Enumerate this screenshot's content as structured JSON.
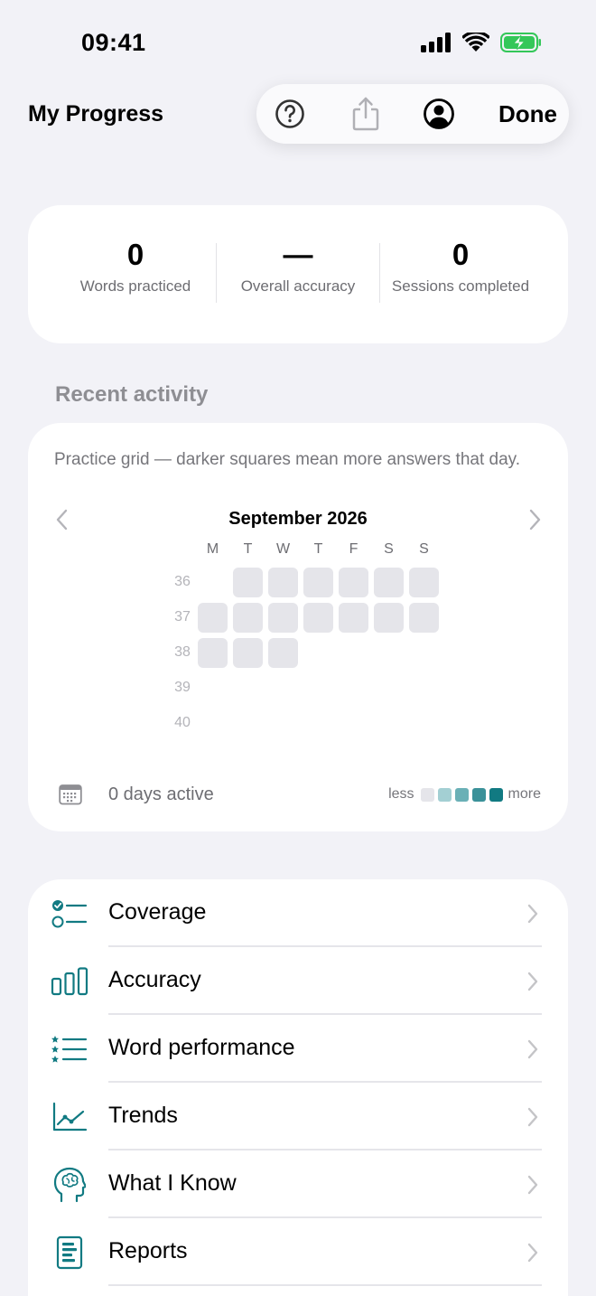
{
  "status_bar": {
    "time": "09:41"
  },
  "header": {
    "title": "My Progress",
    "toolbar": {
      "help_icon": "question-circle-icon",
      "share_icon": "share-icon",
      "account_icon": "person-circle-icon",
      "done_label": "Done"
    }
  },
  "stats": [
    {
      "value": "0",
      "label": "Words practiced"
    },
    {
      "value": "—",
      "label": "Overall accuracy"
    },
    {
      "value": "0",
      "label": "Sessions completed"
    }
  ],
  "recent_activity": {
    "header": "Recent activity",
    "description": "Practice grid — darker squares mean more answers that day.",
    "month": "September 2026",
    "weekdays": [
      "M",
      "T",
      "W",
      "T",
      "F",
      "S",
      "S"
    ],
    "weeks": [
      "36",
      "37",
      "38",
      "39",
      "40"
    ],
    "days_active": "0 days active",
    "legend": {
      "less": "less",
      "more": "more",
      "colors": [
        "#e5e5ea",
        "#a3cfd3",
        "#6ab0b6",
        "#3a9199",
        "#117a82"
      ]
    }
  },
  "menu": [
    {
      "label": "Coverage",
      "icon": "checklist-icon"
    },
    {
      "label": "Accuracy",
      "icon": "bar-chart-icon"
    },
    {
      "label": "Word performance",
      "icon": "star-list-icon"
    },
    {
      "label": "Trends",
      "icon": "line-chart-icon"
    },
    {
      "label": "What I Know",
      "icon": "brain-head-icon"
    },
    {
      "label": "Reports",
      "icon": "report-document-icon"
    }
  ],
  "colors": {
    "accent": "#117a82",
    "background": "#f2f2f7",
    "card": "#ffffff",
    "cell_empty": "#e5e5ea"
  }
}
